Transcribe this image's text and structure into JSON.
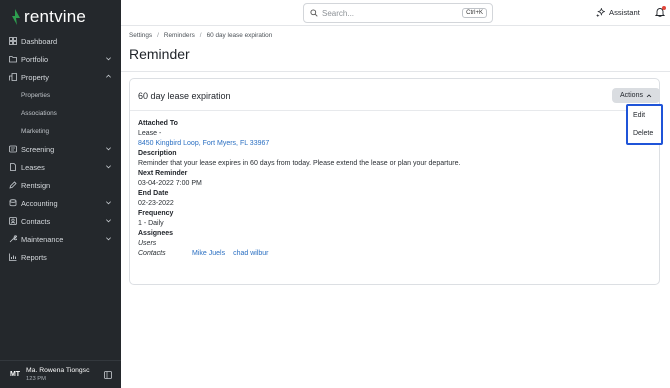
{
  "brand": {
    "name": "rentvine",
    "accent": "#2e9e4f"
  },
  "sidebar": {
    "items": [
      {
        "label": "Dashboard",
        "icon": "dashboard-icon",
        "expandable": false
      },
      {
        "label": "Portfolio",
        "icon": "folder-icon",
        "expandable": true
      },
      {
        "label": "Property",
        "icon": "building-icon",
        "expandable": true,
        "expanded": true
      }
    ],
    "property_sub": [
      "Properties",
      "Associations",
      "Marketing"
    ],
    "items_after": [
      {
        "label": "Screening",
        "icon": "screening-icon",
        "expandable": true
      },
      {
        "label": "Leases",
        "icon": "document-icon",
        "expandable": true
      },
      {
        "label": "Rentsign",
        "icon": "pen-icon",
        "expandable": false
      },
      {
        "label": "Accounting",
        "icon": "coins-icon",
        "expandable": true
      },
      {
        "label": "Contacts",
        "icon": "contacts-icon",
        "expandable": true
      },
      {
        "label": "Maintenance",
        "icon": "wrench-icon",
        "expandable": true
      },
      {
        "label": "Reports",
        "icon": "chart-icon",
        "expandable": false
      }
    ],
    "user": {
      "initials": "MT",
      "name": "Ma. Rowena Tiongsc",
      "sub": "123 PM"
    }
  },
  "topbar": {
    "search_placeholder": "Search...",
    "search_shortcut": "Ctrl+K",
    "assistant_label": "Assistant"
  },
  "breadcrumb": [
    "Settings",
    "Reminders",
    "60 day lease expiration"
  ],
  "page_title": "Reminder",
  "card": {
    "title": "60 day lease expiration",
    "actions_label": "Actions",
    "menu": [
      "Edit",
      "Delete"
    ]
  },
  "details": {
    "attached_to_label": "Attached To",
    "attached_to_value": "Lease -",
    "attached_to_link": "8450 Kingbird Loop, Fort Myers, FL 33967",
    "description_label": "Description",
    "description_value": "Reminder that your lease expires in 60 days from today. Please extend the lease or plan your departure.",
    "next_reminder_label": "Next Reminder",
    "next_reminder_value": "03-04-2022 7:00 PM",
    "end_date_label": "End Date",
    "end_date_value": "02-23-2022",
    "frequency_label": "Frequency",
    "frequency_value": "1 - Daily",
    "assignees_label": "Assignees",
    "users_label": "Users",
    "contacts_label": "Contacts",
    "contacts": [
      "Mike Juels",
      "chad wilbur"
    ]
  }
}
